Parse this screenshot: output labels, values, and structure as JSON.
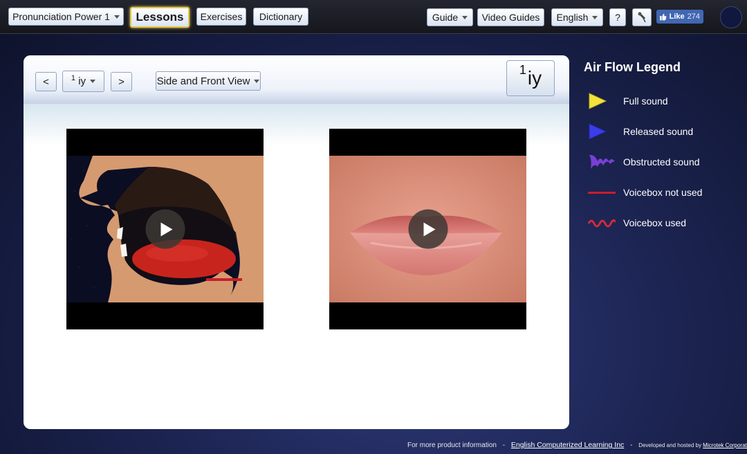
{
  "topbar": {
    "course": "Pronunciation Power 1",
    "lessons": "Lessons",
    "exercises": "Exercises",
    "dictionary": "Dictionary",
    "guide": "Guide",
    "video_guides": "Video Guides",
    "language": "English",
    "help": "?",
    "tool_icon": "pin-icon",
    "fb_like": "Like",
    "fb_count": "274"
  },
  "panel": {
    "prev": "<",
    "next": ">",
    "sound_num": "1",
    "sound_name": "iy",
    "view_select": "Side and Front View",
    "big_num": "1",
    "big_name": "iy"
  },
  "legend": {
    "title": "Air Flow Legend",
    "items": [
      {
        "label": "Full sound",
        "icon": "yellow-triangle-icon",
        "color": "#f2e33a"
      },
      {
        "label": "Released sound",
        "icon": "blue-triangle-icon",
        "color": "#3b3ee6"
      },
      {
        "label": "Obstructed sound",
        "icon": "purple-wave-icon",
        "color": "#7a3fd6"
      },
      {
        "label": "Voicebox not used",
        "icon": "red-line-icon",
        "color": "#c81e2a"
      },
      {
        "label": "Voicebox used",
        "icon": "red-wave-icon",
        "color": "#d42a3a"
      }
    ]
  },
  "footer": {
    "info": "For more product information",
    "link1": "English Computerized Learning Inc",
    "dev_text": "Developed and hosted by",
    "link2": "Microtek Corporation"
  }
}
